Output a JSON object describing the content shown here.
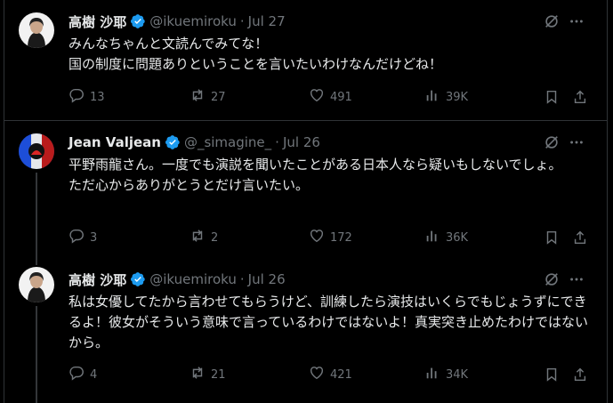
{
  "tweets": [
    {
      "name": "高樹 沙耶",
      "handle": "@ikuemiroku",
      "date": "Jul 27",
      "text": "みんなちゃんと文読んでみてな！\n国の制度に問題ありということを言いたいわけなんだけどね！",
      "replies": "13",
      "retweets": "27",
      "likes": "491",
      "views": "39K"
    },
    {
      "name": "Jean Valjean",
      "handle": "@_simagine_",
      "date": "Jul 26",
      "text": "平野雨龍さん。一度でも演説を聞いたことがある日本人なら疑いもしないでしょ。\nただ心からありがとうとだけ言いたい。",
      "replies": "3",
      "retweets": "2",
      "likes": "172",
      "views": "36K"
    },
    {
      "name": "高樹 沙耶",
      "handle": "@ikuemiroku",
      "date": "Jul 26",
      "text": "私は女優してたから言わせてもらうけど、訓練したら演技はいくらでもじょうずにできるよ！彼女がそういう意味で言っているわけではないよ！真実突き止めたわけではないから。",
      "replies": "4",
      "retweets": "21",
      "likes": "421",
      "views": "34K"
    }
  ],
  "colors": {
    "background": "#000000",
    "text": "#e7e9ea",
    "muted": "#71767b",
    "verified": "#1d9bf0",
    "border": "#2f3336"
  },
  "icons": [
    "verified-badge-icon",
    "grok-icon",
    "more-icon",
    "reply-icon",
    "retweet-icon",
    "like-icon",
    "views-icon",
    "bookmark-icon",
    "share-icon"
  ]
}
